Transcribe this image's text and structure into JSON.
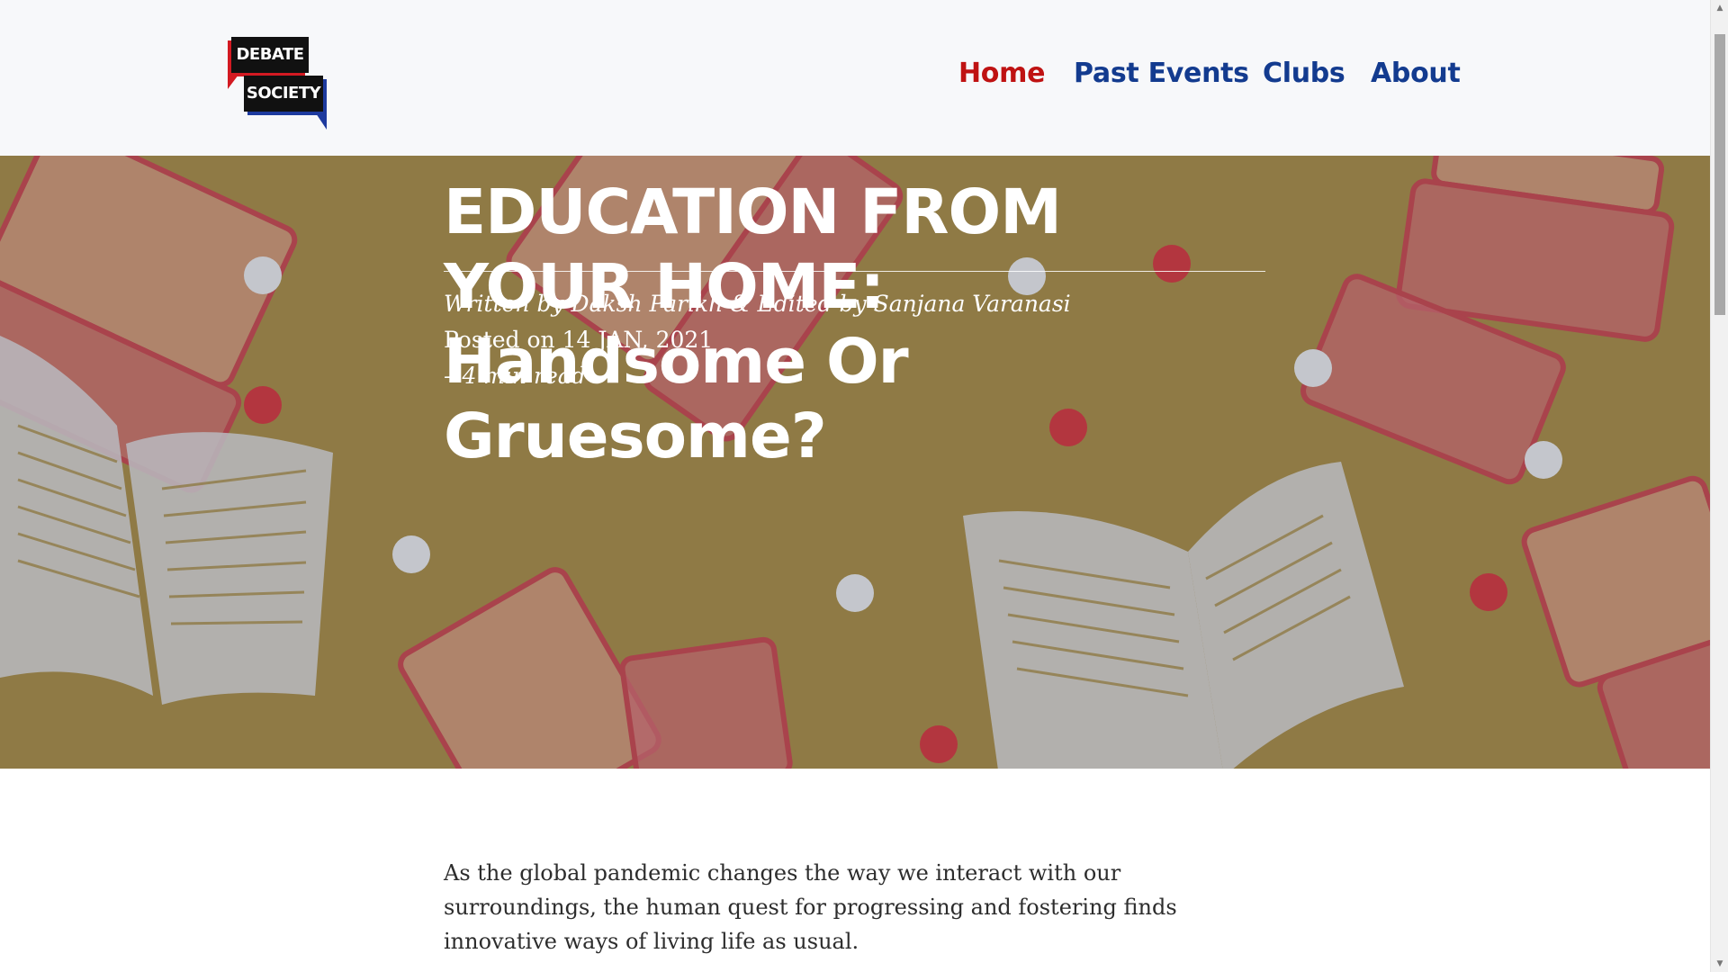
{
  "header": {
    "logo": {
      "line1": "DEBATE",
      "line2": "SOCIETY"
    },
    "nav": [
      {
        "label": "Home",
        "active": true
      },
      {
        "label": "Past Events",
        "active": false
      },
      {
        "label": "Clubs",
        "active": false
      },
      {
        "label": "About",
        "active": false
      }
    ]
  },
  "hero": {
    "title": "EDUCATION FROM YOUR HOME: Handsome Or Gruesome?",
    "byline": "Written by Daksh Parikh & Edited by Sanjana Varanasi",
    "posted": "Posted on 14 JAN, 2021",
    "read_time": " – 4 min read"
  },
  "article": {
    "intro": "As the global pandemic changes the way we interact with our surroundings, the human quest for progressing and fostering finds innovative ways of living life as usual."
  },
  "colors": {
    "nav_active": "#bf1212",
    "nav_link": "#133b8f",
    "hero_bg": "#8f7a45",
    "laptop": "#c1575b",
    "book": "#b9bac0"
  },
  "icons": {
    "scroll_up": "▲",
    "scroll_down": "▼"
  }
}
